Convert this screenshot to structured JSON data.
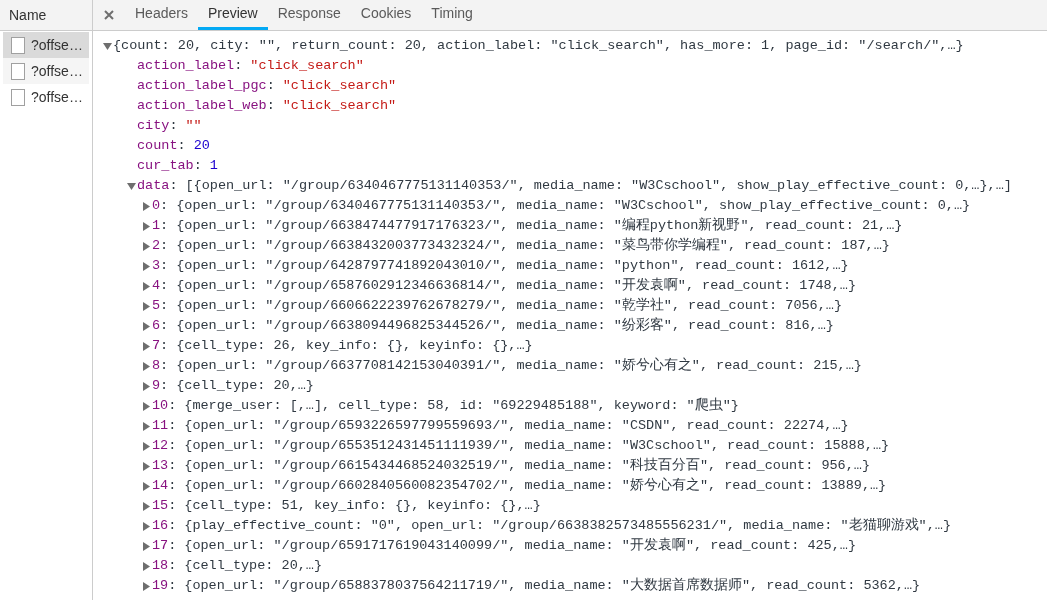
{
  "requests": {
    "header": "Name",
    "items": [
      {
        "name": "?offse…",
        "selected": true
      },
      {
        "name": "?offse…",
        "selected": false
      },
      {
        "name": "?offse…",
        "selected": false
      }
    ]
  },
  "tabs": [
    {
      "label": "Headers",
      "selected": false
    },
    {
      "label": "Preview",
      "selected": true
    },
    {
      "label": "Response",
      "selected": false
    },
    {
      "label": "Cookies",
      "selected": false
    },
    {
      "label": "Timing",
      "selected": false
    }
  ],
  "preview": {
    "summary": "{count: 20, city: \"\", return_count: 20, action_label: \"click_search\", has_more: 1, page_id: \"/search/\",…}",
    "expanded": true,
    "children": [
      {
        "key": "action_label:",
        "value": "\"click_search\"",
        "kind": "string"
      },
      {
        "key": "action_label_pgc:",
        "value": "\"click_search\"",
        "kind": "string"
      },
      {
        "key": "action_label_web:",
        "value": "\"click_search\"",
        "kind": "string"
      },
      {
        "key": "city:",
        "value": "\"\"",
        "kind": "string"
      },
      {
        "key": "count:",
        "value": "20",
        "kind": "number"
      },
      {
        "key": "cur_tab:",
        "value": "1",
        "kind": "number"
      },
      {
        "key": "data:",
        "value": "[{open_url: \"/group/6340467775131140353/\", media_name: \"W3Cschool\", show_play_effective_count: 0,…},…]",
        "kind": "preview",
        "expanded": true,
        "children": [
          {
            "key": "0:",
            "value": "{open_url: \"/group/6340467775131140353/\", media_name: \"W3Cschool\", show_play_effective_count: 0,…}",
            "kind": "preview",
            "expanded": false
          },
          {
            "key": "1:",
            "value": "{open_url: \"/group/6638474477917176323/\", media_name: \"编程python新视野\", read_count: 21,…}",
            "kind": "preview",
            "expanded": false
          },
          {
            "key": "2:",
            "value": "{open_url: \"/group/6638432003773432324/\", media_name: \"菜鸟带你学编程\", read_count: 187,…}",
            "kind": "preview",
            "expanded": false
          },
          {
            "key": "3:",
            "value": "{open_url: \"/group/6428797741892043010/\", media_name: \"python\", read_count: 1612,…}",
            "kind": "preview",
            "expanded": false
          },
          {
            "key": "4:",
            "value": "{open_url: \"/group/6587602912346636814/\", media_name: \"开发袁啊\", read_count: 1748,…}",
            "kind": "preview",
            "expanded": false
          },
          {
            "key": "5:",
            "value": "{open_url: \"/group/6606622239762678279/\", media_name: \"乾学社\", read_count: 7056,…}",
            "kind": "preview",
            "expanded": false
          },
          {
            "key": "6:",
            "value": "{open_url: \"/group/6638094496825344526/\", media_name: \"纷彩客\", read_count: 816,…}",
            "kind": "preview",
            "expanded": false
          },
          {
            "key": "7:",
            "value": "{cell_type: 26, key_info: {}, keyinfo: {},…}",
            "kind": "preview",
            "expanded": false
          },
          {
            "key": "8:",
            "value": "{open_url: \"/group/6637708142153040391/\", media_name: \"娇兮心有之\", read_count: 215,…}",
            "kind": "preview",
            "expanded": false
          },
          {
            "key": "9:",
            "value": "{cell_type: 20,…}",
            "kind": "preview",
            "expanded": false
          },
          {
            "key": "10:",
            "value": "{merge_user: [,…], cell_type: 58, id: \"69229485188\", keyword: \"爬虫\"}",
            "kind": "preview",
            "expanded": false
          },
          {
            "key": "11:",
            "value": "{open_url: \"/group/6593226597799559693/\", media_name: \"CSDN\", read_count: 22274,…}",
            "kind": "preview",
            "expanded": false
          },
          {
            "key": "12:",
            "value": "{open_url: \"/group/6553512431451111939/\", media_name: \"W3Cschool\", read_count: 15888,…}",
            "kind": "preview",
            "expanded": false
          },
          {
            "key": "13:",
            "value": "{open_url: \"/group/6615434468524032519/\", media_name: \"科技百分百\", read_count: 956,…}",
            "kind": "preview",
            "expanded": false
          },
          {
            "key": "14:",
            "value": "{open_url: \"/group/6602840560082354702/\", media_name: \"娇兮心有之\", read_count: 13889,…}",
            "kind": "preview",
            "expanded": false
          },
          {
            "key": "15:",
            "value": "{cell_type: 51, key_info: {}, keyinfo: {},…}",
            "kind": "preview",
            "expanded": false
          },
          {
            "key": "16:",
            "value": "{play_effective_count: \"0\", open_url: \"/group/6638382573485556231/\", media_name: \"老猫聊游戏\",…}",
            "kind": "preview",
            "expanded": false
          },
          {
            "key": "17:",
            "value": "{open_url: \"/group/6591717619043140099/\", media_name: \"开发袁啊\", read_count: 425,…}",
            "kind": "preview",
            "expanded": false
          },
          {
            "key": "18:",
            "value": "{cell_type: 20,…}",
            "kind": "preview",
            "expanded": false
          },
          {
            "key": "19:",
            "value": "{open_url: \"/group/6588378037564211719/\", media_name: \"大数据首席数据师\", read_count: 5362,…}",
            "kind": "preview",
            "expanded": false
          }
        ]
      }
    ]
  }
}
